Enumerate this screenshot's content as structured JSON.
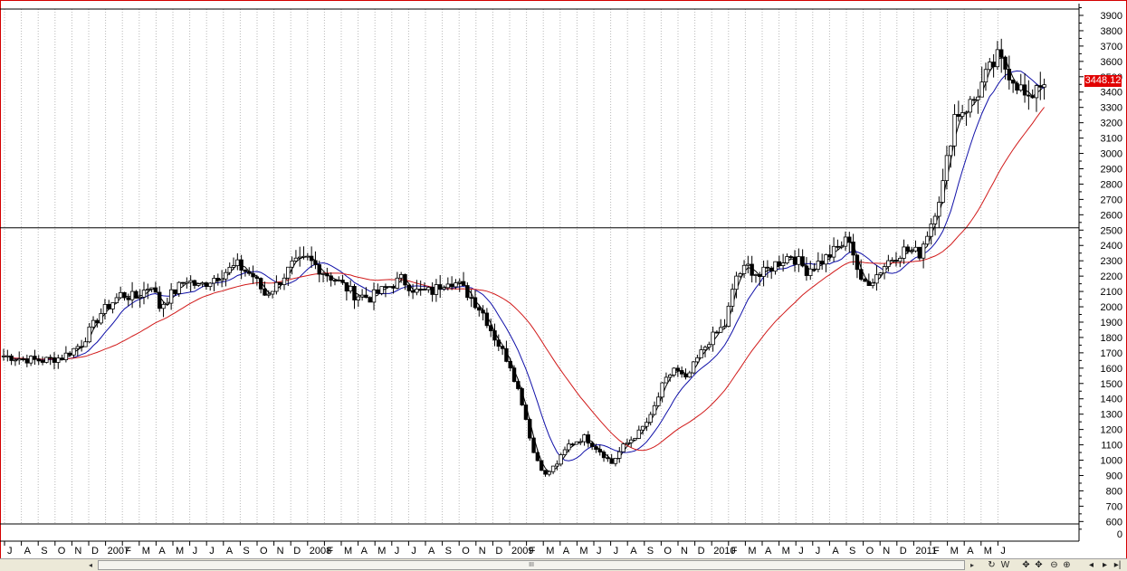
{
  "chart_data": {
    "type": "candlestick",
    "title": "",
    "xlabel": "",
    "ylabel": "",
    "ylim": [
      500,
      3950
    ],
    "y_ticks": [
      600,
      700,
      800,
      900,
      1000,
      1100,
      1200,
      1300,
      1400,
      1500,
      1600,
      1700,
      1800,
      1900,
      2000,
      2100,
      2200,
      2300,
      2400,
      2500,
      2600,
      2700,
      2800,
      2900,
      3000,
      3100,
      3200,
      3300,
      3400,
      3500,
      3600,
      3700,
      3800,
      3900
    ],
    "y_tick_lower_pane": "0",
    "last_price": "3448.12",
    "last_price_value": 3448.12,
    "horizontal_line": 2515,
    "x_tick_labels": [
      "J",
      "A",
      "S",
      "O",
      "N",
      "D",
      "2007",
      "F",
      "M",
      "A",
      "M",
      "J",
      "J",
      "A",
      "S",
      "O",
      "N",
      "D",
      "2008",
      "F",
      "M",
      "A",
      "M",
      "J",
      "J",
      "A",
      "S",
      "O",
      "N",
      "D",
      "2009",
      "F",
      "M",
      "A",
      "M",
      "J",
      "J",
      "A",
      "S",
      "O",
      "N",
      "D",
      "2010",
      "F",
      "M",
      "A",
      "M",
      "J",
      "J",
      "A",
      "S",
      "O",
      "N",
      "D",
      "2011",
      "F",
      "M",
      "A",
      "M",
      "J"
    ],
    "weeks": 252,
    "close_path": [
      [
        0,
        1680
      ],
      [
        5,
        1660
      ],
      [
        10,
        1650
      ],
      [
        15,
        1670
      ],
      [
        20,
        1760
      ],
      [
        25,
        1960
      ],
      [
        30,
        2080
      ],
      [
        34,
        2060
      ],
      [
        38,
        2150
      ],
      [
        40,
        2000
      ],
      [
        43,
        2080
      ],
      [
        47,
        2180
      ],
      [
        50,
        2130
      ],
      [
        54,
        2190
      ],
      [
        57,
        2230
      ],
      [
        60,
        2270
      ],
      [
        64,
        2200
      ],
      [
        67,
        2080
      ],
      [
        70,
        2140
      ],
      [
        74,
        2270
      ],
      [
        78,
        2310
      ],
      [
        82,
        2230
      ],
      [
        86,
        2160
      ],
      [
        90,
        2080
      ],
      [
        94,
        2060
      ],
      [
        98,
        2120
      ],
      [
        102,
        2180
      ],
      [
        106,
        2100
      ],
      [
        110,
        2100
      ],
      [
        114,
        2180
      ],
      [
        117,
        2140
      ],
      [
        120,
        2060
      ],
      [
        123,
        1960
      ],
      [
        126,
        1800
      ],
      [
        130,
        1620
      ],
      [
        133,
        1380
      ],
      [
        136,
        1050
      ],
      [
        139,
        900
      ],
      [
        142,
        980
      ],
      [
        145,
        1100
      ],
      [
        149,
        1150
      ],
      [
        153,
        1060
      ],
      [
        156,
        980
      ],
      [
        159,
        1090
      ],
      [
        163,
        1180
      ],
      [
        166,
        1280
      ],
      [
        169,
        1480
      ],
      [
        172,
        1600
      ],
      [
        175,
        1520
      ],
      [
        178,
        1660
      ],
      [
        181,
        1780
      ],
      [
        185,
        1880
      ],
      [
        188,
        2200
      ],
      [
        191,
        2260
      ],
      [
        194,
        2200
      ],
      [
        198,
        2280
      ],
      [
        202,
        2340
      ],
      [
        206,
        2240
      ],
      [
        210,
        2300
      ],
      [
        214,
        2380
      ],
      [
        217,
        2450
      ],
      [
        220,
        2150
      ],
      [
        223,
        2180
      ],
      [
        227,
        2300
      ],
      [
        231,
        2370
      ],
      [
        235,
        2350
      ],
      [
        238,
        2550
      ],
      [
        241,
        2800
      ],
      [
        244,
        3250
      ],
      [
        247,
        3300
      ],
      [
        249,
        3350
      ],
      [
        252,
        3500
      ],
      [
        255,
        3620
      ],
      [
        258,
        3530
      ],
      [
        261,
        3420
      ],
      [
        263,
        3320
      ],
      [
        265,
        3460
      ],
      [
        267,
        3448
      ]
    ],
    "ma_short_color": "#1010a8",
    "ma_long_color": "#d11a1a",
    "ma_short_period": 10,
    "ma_long_period": 30,
    "colors": {
      "candle_line": "#000000",
      "candle_up": "#ffffff",
      "candle_down": "#000000",
      "grid": "#b8b8b8",
      "frame": "#d40000",
      "price_box": "#e10000",
      "hline": "#000000"
    }
  },
  "scrollbar": {
    "left_arrow": "◂",
    "right_arrow": "▸",
    "thumb_grip": "III"
  },
  "toolbar": {
    "refresh": "↻",
    "weekly": "W",
    "move": "✥",
    "move2": "✥",
    "zoom_out": "⊖",
    "zoom_in": "⊕",
    "prev": "◂",
    "play": "▸",
    "next": "▸|"
  }
}
